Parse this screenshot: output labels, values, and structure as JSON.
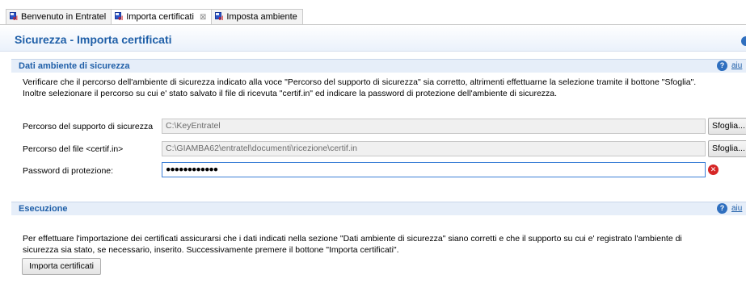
{
  "tabs": [
    {
      "label": "Benvenuto in Entratel",
      "active": false,
      "closable": false
    },
    {
      "label": "Importa certificati",
      "active": true,
      "closable": true,
      "close_glyph": "⊠"
    },
    {
      "label": "Imposta ambiente",
      "active": false,
      "closable": false
    }
  ],
  "page": {
    "title": "Sicurezza - Importa certificati"
  },
  "sections": {
    "security": {
      "title": "Dati ambiente di sicurezza",
      "help_label": "aiu",
      "description_line1": "Verificare che il percorso dell'ambiente di sicurezza indicato alla voce \"Percorso del supporto di sicurezza\" sia corretto, altrimenti effettuarne la selezione tramite il bottone \"Sfoglia\".",
      "description_line2": "Inoltre selezionare il percorso su cui e' stato salvato il file di ricevuta \"certif.in\" ed indicare la password di protezione dell'ambiente di sicurezza.",
      "fields": {
        "support_path": {
          "label": "Percorso del supporto di sicurezza",
          "value": "C:\\KeyEntratel",
          "button": "Sfoglia..."
        },
        "certif_path": {
          "label": "Percorso del file <certif.in>",
          "value": "C:\\GIAMBA62\\entratel\\documenti\\ricezione\\certif.in",
          "button": "Sfoglia..."
        },
        "password": {
          "label": "Password di protezione:",
          "value": "●●●●●●●●●●●●"
        }
      }
    },
    "execution": {
      "title": "Esecuzione",
      "help_label": "aiu",
      "description_line1": "Per effettuare l'importazione dei certificati assicurarsi che i dati indicati nella sezione \"Dati ambiente di sicurezza\" siano corretti e che il supporto su cui e' registrato l'ambiente di",
      "description_line2": "sicurezza sia stato, se necessario, inserito. Successivamente premere il bottone \"Importa certificati\".",
      "button": "Importa certificati"
    }
  },
  "icons": {
    "help": "help-icon",
    "error": "error-icon",
    "tab": "entratel-app-icon"
  },
  "glyphs": {
    "help": "?",
    "error": "✕",
    "app_mark": "el"
  },
  "colors": {
    "title": "#1f5fa8",
    "section_bg": "#e6eef9",
    "focus_border": "#3c7fd6",
    "error": "#d62626"
  }
}
